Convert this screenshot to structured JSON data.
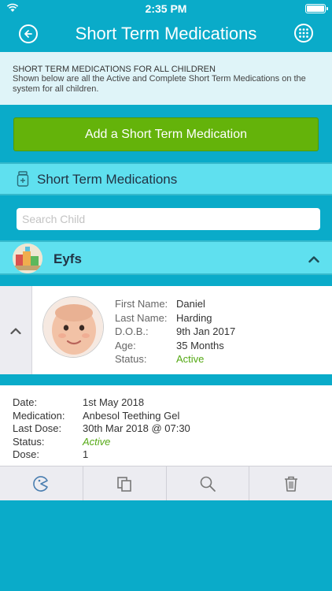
{
  "status_bar": {
    "time": "2:35 PM"
  },
  "nav": {
    "title": "Short Term Medications"
  },
  "info": {
    "heading": "SHORT TERM MEDICATIONS FOR ALL CHILDREN",
    "description": "Shown below are all the Active and Complete Short Term Medications on the system for all children."
  },
  "add_button": {
    "label": "Add a Short Term Medication"
  },
  "section": {
    "label": "Short Term Medications"
  },
  "search": {
    "placeholder": "Search Child"
  },
  "group": {
    "name": "Eyfs"
  },
  "child": {
    "labels": [
      "First Name:",
      "Last Name:",
      "D.O.B.:",
      "Age:",
      "Status:"
    ],
    "first_name": "Daniel",
    "last_name": "Harding",
    "dob": "9th Jan 2017",
    "age": "35 Months",
    "status": "Active"
  },
  "medication": {
    "labels": [
      "Date:",
      "Medication:",
      "Last Dose:",
      "Status:",
      "Dose:"
    ],
    "date": "1st May 2018",
    "name": "Anbesol Teething Gel",
    "last_dose": "30th Mar 2018 @ 07:30",
    "status": "Active",
    "dose": "1"
  },
  "colors": {
    "background": "#0aabc9",
    "add_button": "#64b30a",
    "section_header": "#5fe0ef",
    "active_status": "#55a915"
  },
  "icons": {
    "nav_left": "back-circle-icon",
    "nav_right": "grid-menu-icon",
    "section": "medicine-bottle-icon",
    "group_toggle": "chevron-up-icon",
    "child_toggle": "chevron-up-icon",
    "toolbar": [
      "dose-administer-icon",
      "copy-icon",
      "search-icon",
      "trash-icon"
    ]
  }
}
